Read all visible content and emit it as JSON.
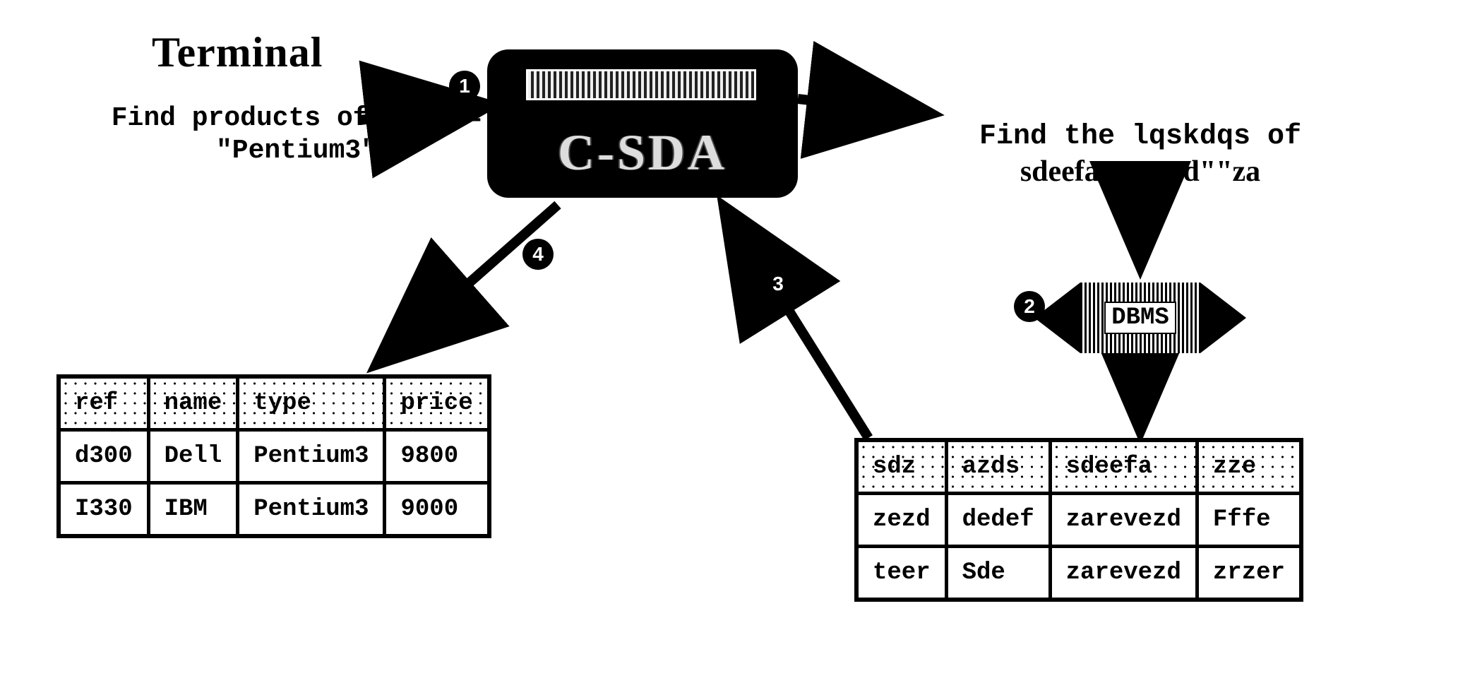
{
  "title": "Terminal",
  "left_query": {
    "line1": "Find products of type =",
    "line2": "\"Pentium3\""
  },
  "right_query": {
    "line1": "Find the lqskdqs of",
    "line2": "sdeefa=revezd\"\"za"
  },
  "csda": {
    "label": "C-SDA"
  },
  "dbms": {
    "label": "DBMS"
  },
  "steps": {
    "s1": "1",
    "s2": "2",
    "s3": "3",
    "s4": "4"
  },
  "left_table": {
    "headers": [
      "ref",
      "name",
      "type",
      "price"
    ],
    "rows": [
      [
        "d300",
        "Dell",
        "Pentium3",
        "9800"
      ],
      [
        "I330",
        "IBM",
        "Pentium3",
        "9000"
      ]
    ]
  },
  "right_table": {
    "headers": [
      "sdz",
      "azds",
      "sdeefa",
      "zze"
    ],
    "rows": [
      [
        "zezd",
        "dedef",
        "zarevezd",
        "Fffe"
      ],
      [
        "teer",
        "Sde",
        "zarevezd",
        "zrzer"
      ]
    ]
  }
}
